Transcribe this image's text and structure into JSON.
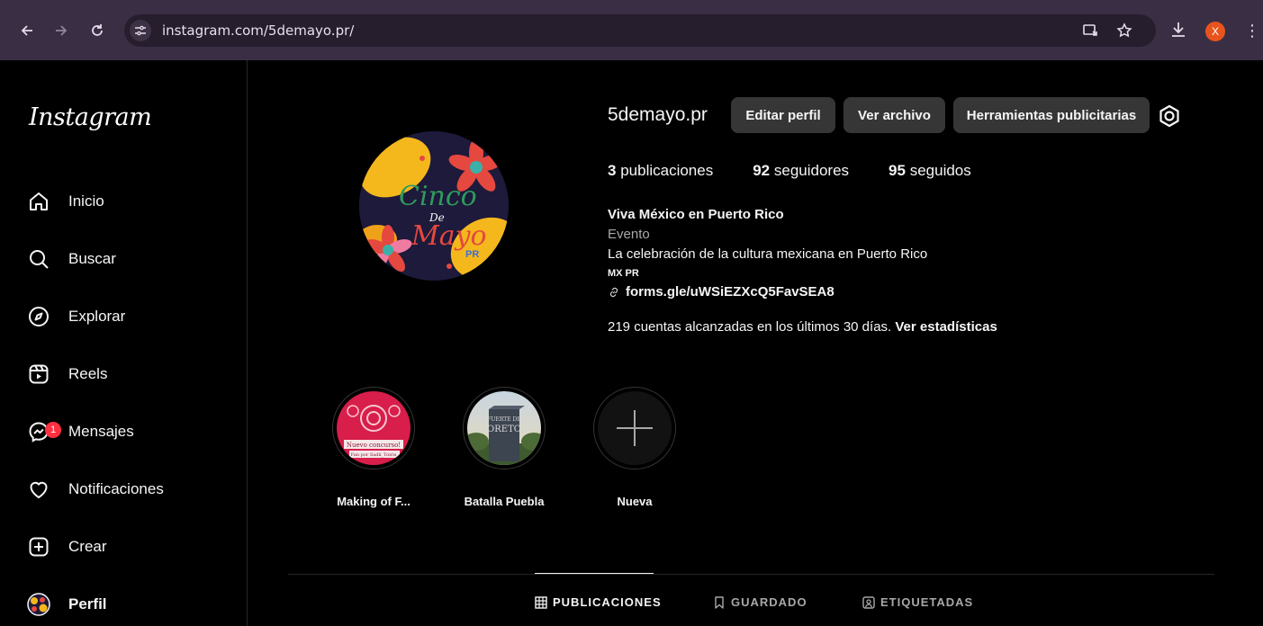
{
  "browser": {
    "url": "instagram.com/5demayo.pr/",
    "profile_initial": "X"
  },
  "sidebar": {
    "logo": "Instagram",
    "items": [
      {
        "label": "Inicio",
        "icon": "home-icon"
      },
      {
        "label": "Buscar",
        "icon": "search-icon"
      },
      {
        "label": "Explorar",
        "icon": "compass-icon"
      },
      {
        "label": "Reels",
        "icon": "reels-icon"
      },
      {
        "label": "Mensajes",
        "icon": "messenger-icon",
        "badge": "1"
      },
      {
        "label": "Notificaciones",
        "icon": "heart-icon"
      },
      {
        "label": "Crear",
        "icon": "plus-square-icon"
      },
      {
        "label": "Perfil",
        "icon": "avatar"
      }
    ]
  },
  "profile": {
    "username": "5demayo.pr",
    "buttons": {
      "edit": "Editar perfil",
      "archive": "Ver archivo",
      "ad_tools": "Herramientas publicitarias"
    },
    "stats": {
      "posts_count": "3",
      "posts_label": "publicaciones",
      "followers_count": "92",
      "followers_label": "seguidores",
      "following_count": "95",
      "following_label": "seguidos"
    },
    "bio": {
      "name": "Viva México en Puerto Rico",
      "category": "Evento",
      "description": "La celebración de la cultura mexicana en Puerto Rico",
      "flags": "MX PR",
      "link": "forms.gle/uWSiEZXcQ5FavSEA8"
    },
    "reach": {
      "text": "219 cuentas alcanzadas en los últimos 30 días.",
      "link": "Ver estadísticas"
    },
    "pic_text": {
      "line1": "Cinco",
      "line2": "De",
      "line3": "Mayo",
      "line4": "PR"
    }
  },
  "highlights": [
    {
      "caption": "Making of F...",
      "overlay_top": "Nuevo concurso!",
      "overlay_bottom": "Fan por Sadii_Toiris"
    },
    {
      "caption": "Batalla Puebla",
      "sign_top": "FUERTE DE",
      "sign_bottom": "ORETO"
    },
    {
      "caption": "Nueva"
    }
  ],
  "tabs": [
    {
      "label": "PUBLICACIONES",
      "icon": "grid-icon",
      "active": true
    },
    {
      "label": "GUARDADO",
      "icon": "bookmark-icon",
      "active": false
    },
    {
      "label": "ETIQUETADAS",
      "icon": "tag-icon",
      "active": false
    }
  ],
  "colors": {
    "background": "#000000",
    "chrome": "#3a2e44",
    "button": "#363636",
    "badge": "#ff3040",
    "muted": "#a8a8a8"
  }
}
